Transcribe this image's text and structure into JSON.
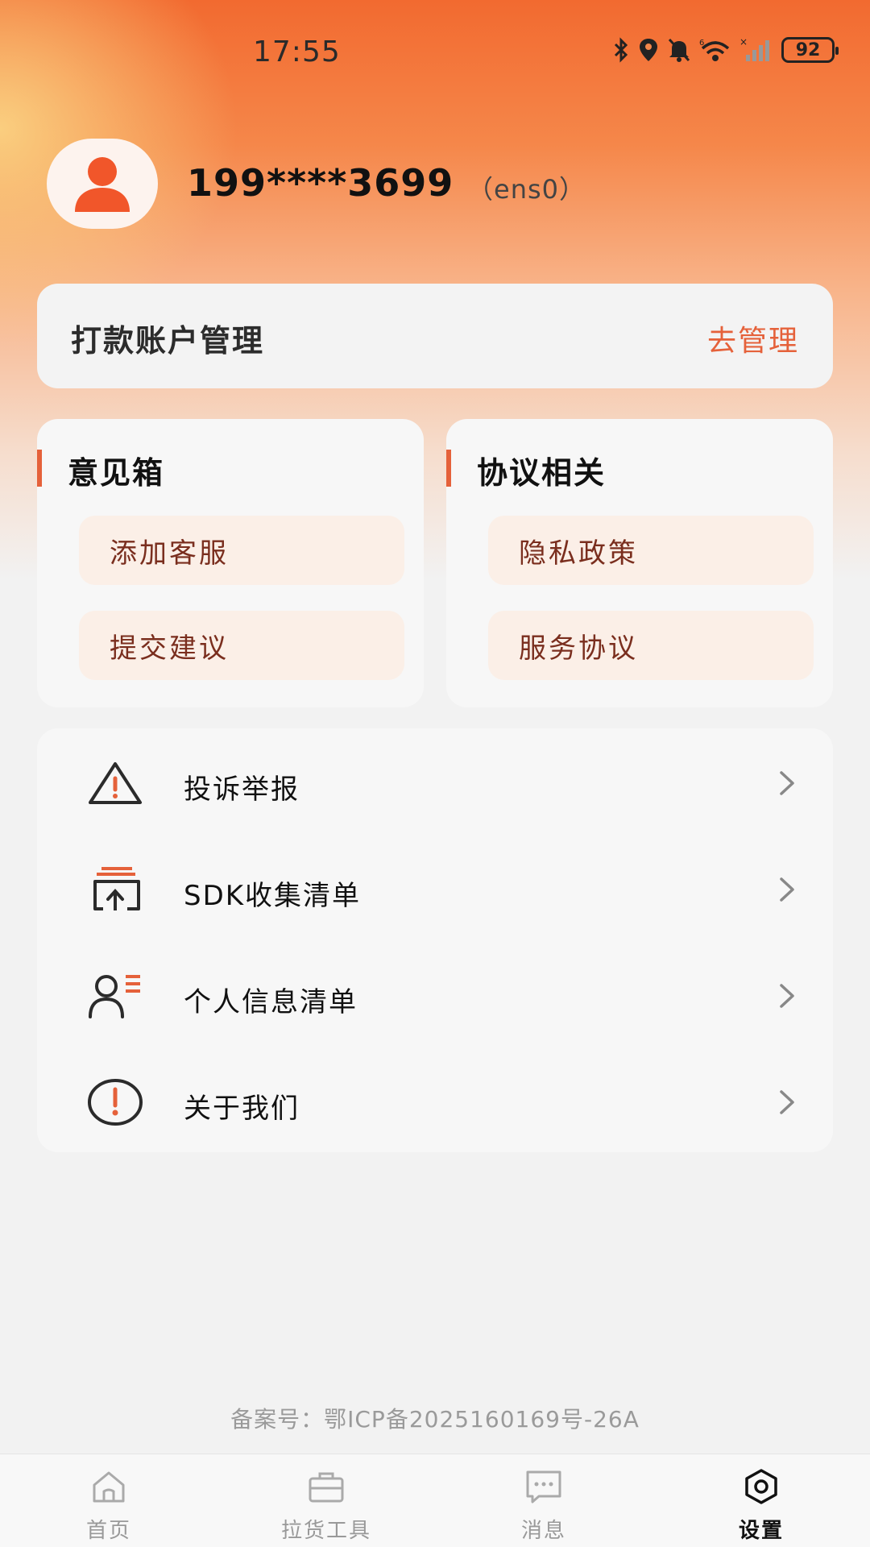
{
  "status_bar": {
    "time": "17:55",
    "battery": "92",
    "signal_note": "6"
  },
  "profile": {
    "phone": "199****3699",
    "nickname": "（ens0）"
  },
  "account_card": {
    "title": "打款账户管理",
    "action": "去管理"
  },
  "feedback_card": {
    "title": "意见箱",
    "items": [
      "添加客服",
      "提交建议"
    ]
  },
  "agreement_card": {
    "title": "协议相关",
    "items": [
      "隐私政策",
      "服务协议"
    ]
  },
  "menu": {
    "items": [
      {
        "label": "投诉举报",
        "icon": "warning-icon"
      },
      {
        "label": "SDK收集清单",
        "icon": "sdk-list-icon"
      },
      {
        "label": "个人信息清单",
        "icon": "personal-info-icon"
      },
      {
        "label": "关于我们",
        "icon": "info-icon"
      }
    ]
  },
  "footer": {
    "icp": "备案号：鄂ICP备2025160169号-26A"
  },
  "tabbar": {
    "items": [
      {
        "label": "首页",
        "icon": "home-icon",
        "active": false
      },
      {
        "label": "拉货工具",
        "icon": "toolbox-icon",
        "active": false
      },
      {
        "label": "消息",
        "icon": "message-icon",
        "active": false
      },
      {
        "label": "设置",
        "icon": "settings-icon",
        "active": true
      }
    ]
  },
  "colors": {
    "accent": "#e5613a",
    "header_top": "#f26a30",
    "pill_bg": "#fbefe7",
    "page_bg": "#f2f2f2"
  }
}
